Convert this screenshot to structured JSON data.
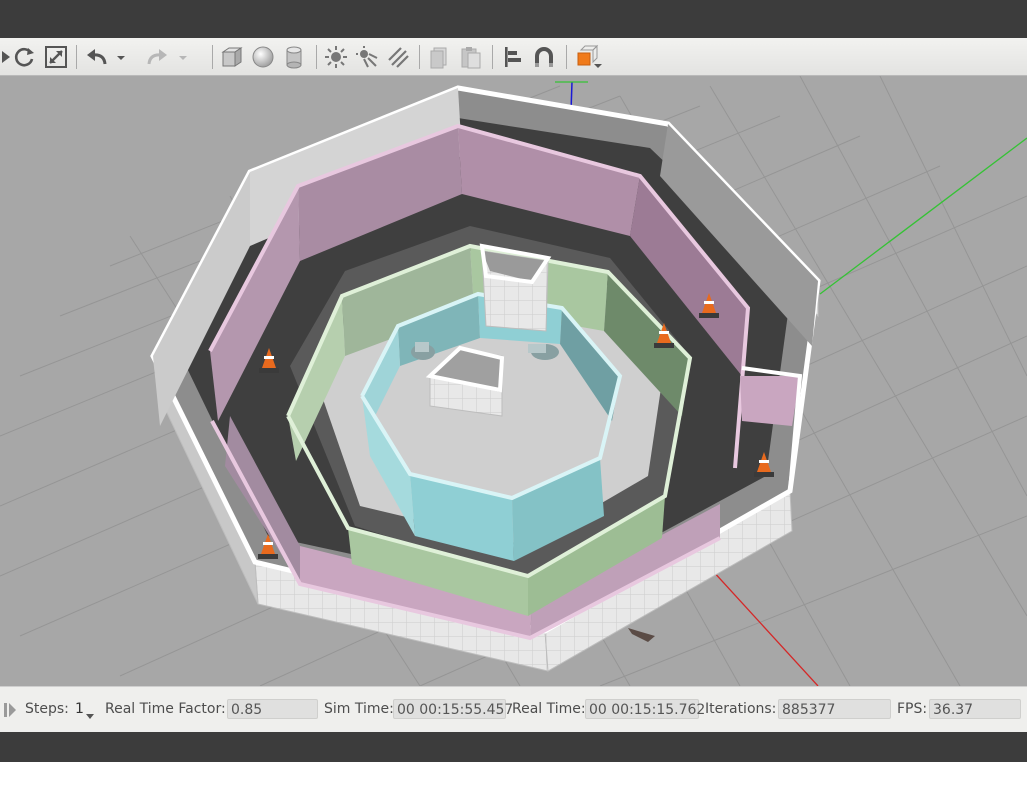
{
  "toolbar": {
    "items": [
      {
        "id": "play-icon",
        "tooltip": ""
      },
      {
        "id": "refresh-icon"
      },
      {
        "id": "fit-icon"
      },
      {
        "id": "undo-icon"
      },
      {
        "id": "redo-icon"
      },
      {
        "id": "box-icon"
      },
      {
        "id": "sphere-icon"
      },
      {
        "id": "cylinder-icon"
      },
      {
        "id": "point-light-icon"
      },
      {
        "id": "spot-light-icon"
      },
      {
        "id": "directional-light-icon"
      },
      {
        "id": "copy-icon"
      },
      {
        "id": "paste-icon"
      },
      {
        "id": "align-icon"
      },
      {
        "id": "magnet-icon"
      },
      {
        "id": "view-angle-icon"
      }
    ],
    "accent_color": "#f07a1a"
  },
  "status": {
    "steps_label": "Steps:",
    "steps_value": "1",
    "rtf_label": "Real Time Factor:",
    "rtf_value": "0.85",
    "sim_time_label": "Sim Time:",
    "sim_time_value": "00 00:15:55.457",
    "real_time_label": "Real Time:",
    "real_time_value": "00 00:15:15.762",
    "iterations_label": "Iterations:",
    "iterations_value": "885377",
    "fps_label": "FPS:",
    "fps_value": "36.37"
  },
  "scene": {
    "background_color": "#a7a7a7",
    "wall_colors": {
      "outer": "#d6d6d6",
      "pink": "#c9a6c0",
      "green": "#a9c7a0",
      "cyan": "#8fcfd4"
    },
    "objects": [
      "outer-octagon-wall",
      "pink-octagon-wall",
      "green-octagon-wall",
      "cyan-octagon-wall",
      "center-pillar",
      "traffic-cone",
      "robot-turtlebot"
    ]
  }
}
